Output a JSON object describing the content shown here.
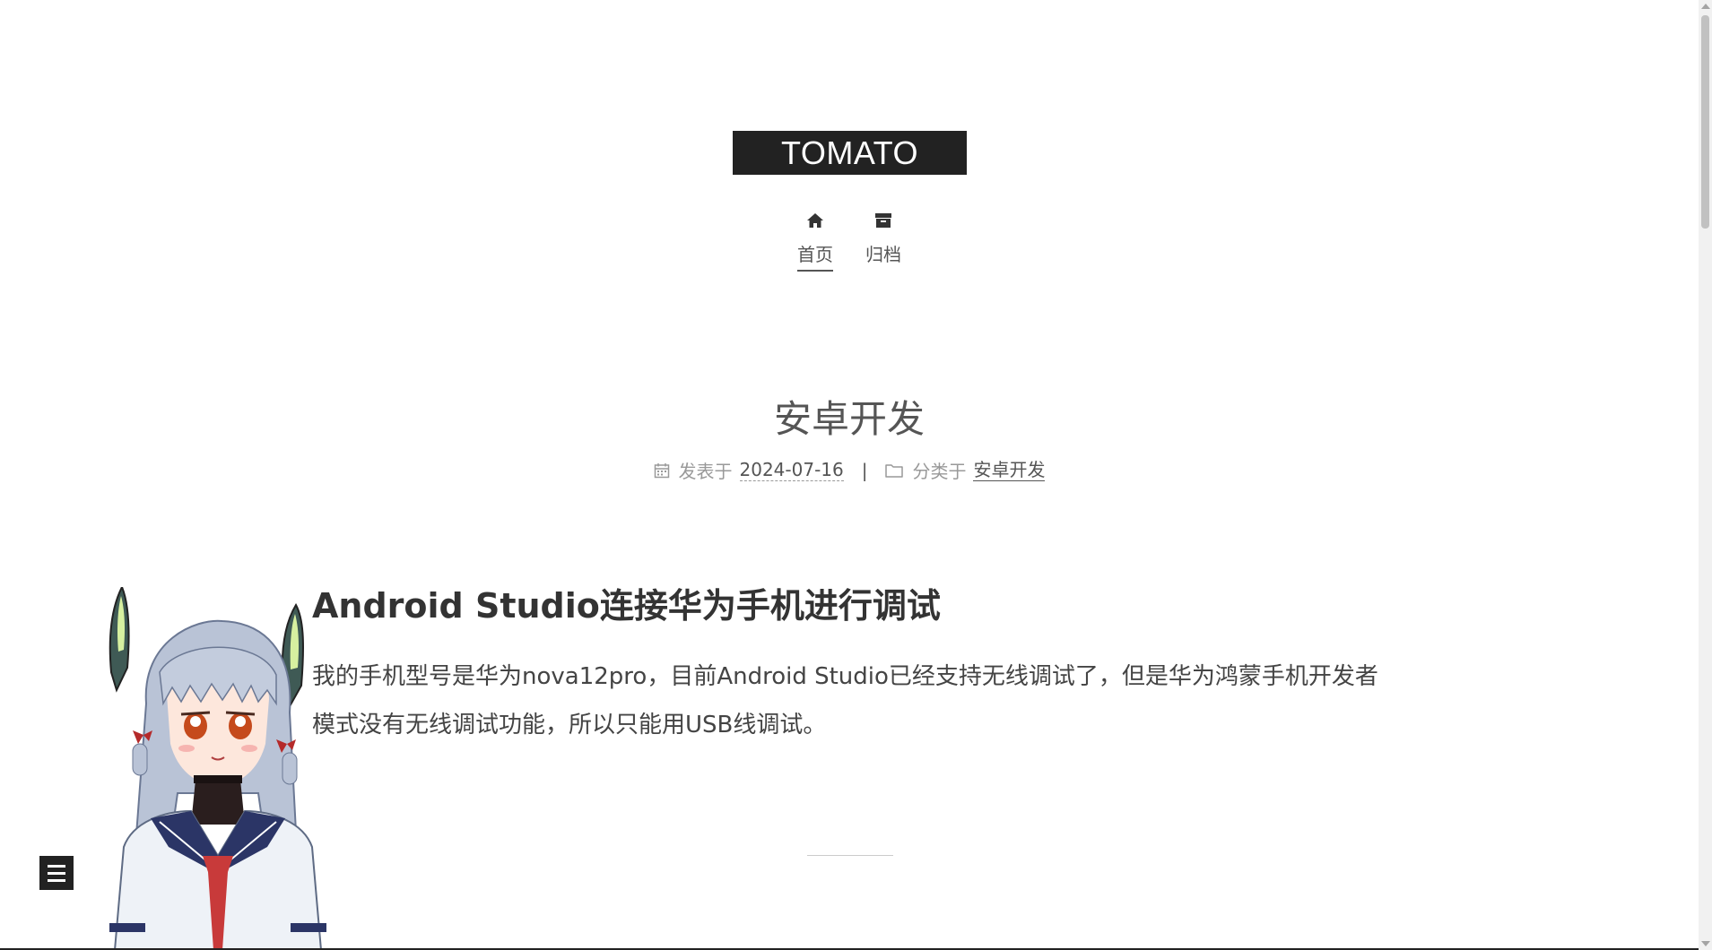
{
  "site": {
    "brand": "TOMATO"
  },
  "nav": {
    "items": [
      {
        "label": "首页",
        "icon": "home-icon",
        "active": true
      },
      {
        "label": "归档",
        "icon": "archive-icon",
        "active": false
      }
    ]
  },
  "post": {
    "title": "安卓开发",
    "meta": {
      "posted_prefix": "发表于",
      "date": "2024-07-16",
      "divider": "|",
      "category_prefix": "分类于",
      "category": "安卓开发"
    },
    "heading": "Android Studio连接华为手机进行调试",
    "body": "我的手机型号是华为nova12pro，目前Android Studio已经支持无线调试了，但是华为鸿蒙手机开发者模式没有无线调试功能，所以只能用USB线调试。"
  },
  "widgets": {
    "sidebar_toggle_icon": "menu-icon",
    "mascot": "live2d-mascot"
  },
  "colors": {
    "brand_bg": "#222222",
    "text": "#555555"
  }
}
